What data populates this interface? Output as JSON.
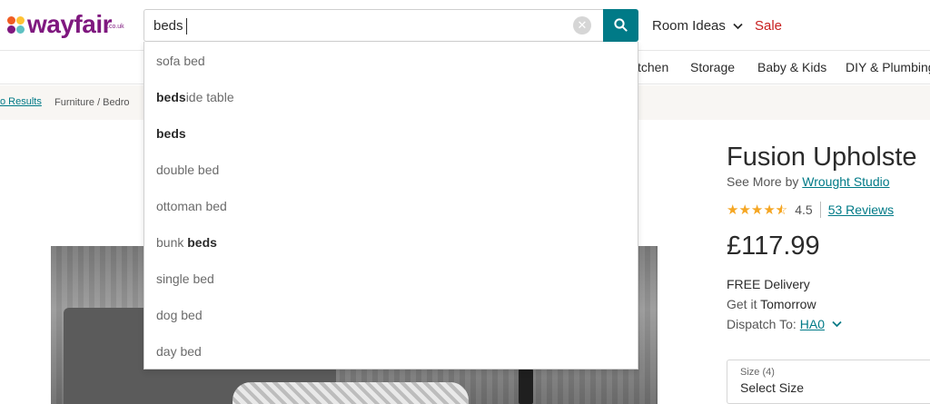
{
  "header": {
    "logo_text": "wayfair",
    "logo_sub": ".co.uk",
    "search": {
      "value": "beds",
      "placeholder": ""
    },
    "nav_room_ideas": "Room Ideas",
    "nav_sale": "Sale"
  },
  "categories": [
    "tchen",
    "Storage",
    "Baby & Kids",
    "DIY & Plumbing"
  ],
  "breadcrumb": {
    "back": "o Results",
    "path": "Furniture  /  Bedro"
  },
  "suggestions": [
    {
      "pre": "sofa bed",
      "hl": "",
      "post": ""
    },
    {
      "pre": "",
      "hl": "beds",
      "post": "ide table"
    },
    {
      "pre": "",
      "hl": "beds",
      "post": ""
    },
    {
      "pre": "double bed",
      "hl": "",
      "post": ""
    },
    {
      "pre": "ottoman bed",
      "hl": "",
      "post": ""
    },
    {
      "pre": "bunk ",
      "hl": "beds",
      "post": ""
    },
    {
      "pre": "single bed",
      "hl": "",
      "post": ""
    },
    {
      "pre": "dog bed",
      "hl": "",
      "post": ""
    },
    {
      "pre": "day bed",
      "hl": "",
      "post": ""
    }
  ],
  "product": {
    "title": "Fusion Upholste",
    "see_more_prefix": "See More by",
    "brand": "Wrought Studio",
    "rating": "4.5",
    "rating_fraction": 0.9,
    "reviews": "53 Reviews",
    "price": "£117.99",
    "delivery": "FREE Delivery",
    "get_it_prefix": "Get it",
    "get_it_when": "Tomorrow",
    "dispatch_prefix": "Dispatch To:",
    "dispatch_code": "HA0",
    "size_label": "Size (4)",
    "size_value": "Select Size"
  },
  "colors": {
    "brand_purple": "#7f187f",
    "accent_teal": "#007a87",
    "sale_red": "#c81e1e",
    "star_orange": "#f5a623"
  },
  "icons": [
    "search-icon",
    "clear-icon",
    "chevron-down-icon",
    "star-icon"
  ]
}
